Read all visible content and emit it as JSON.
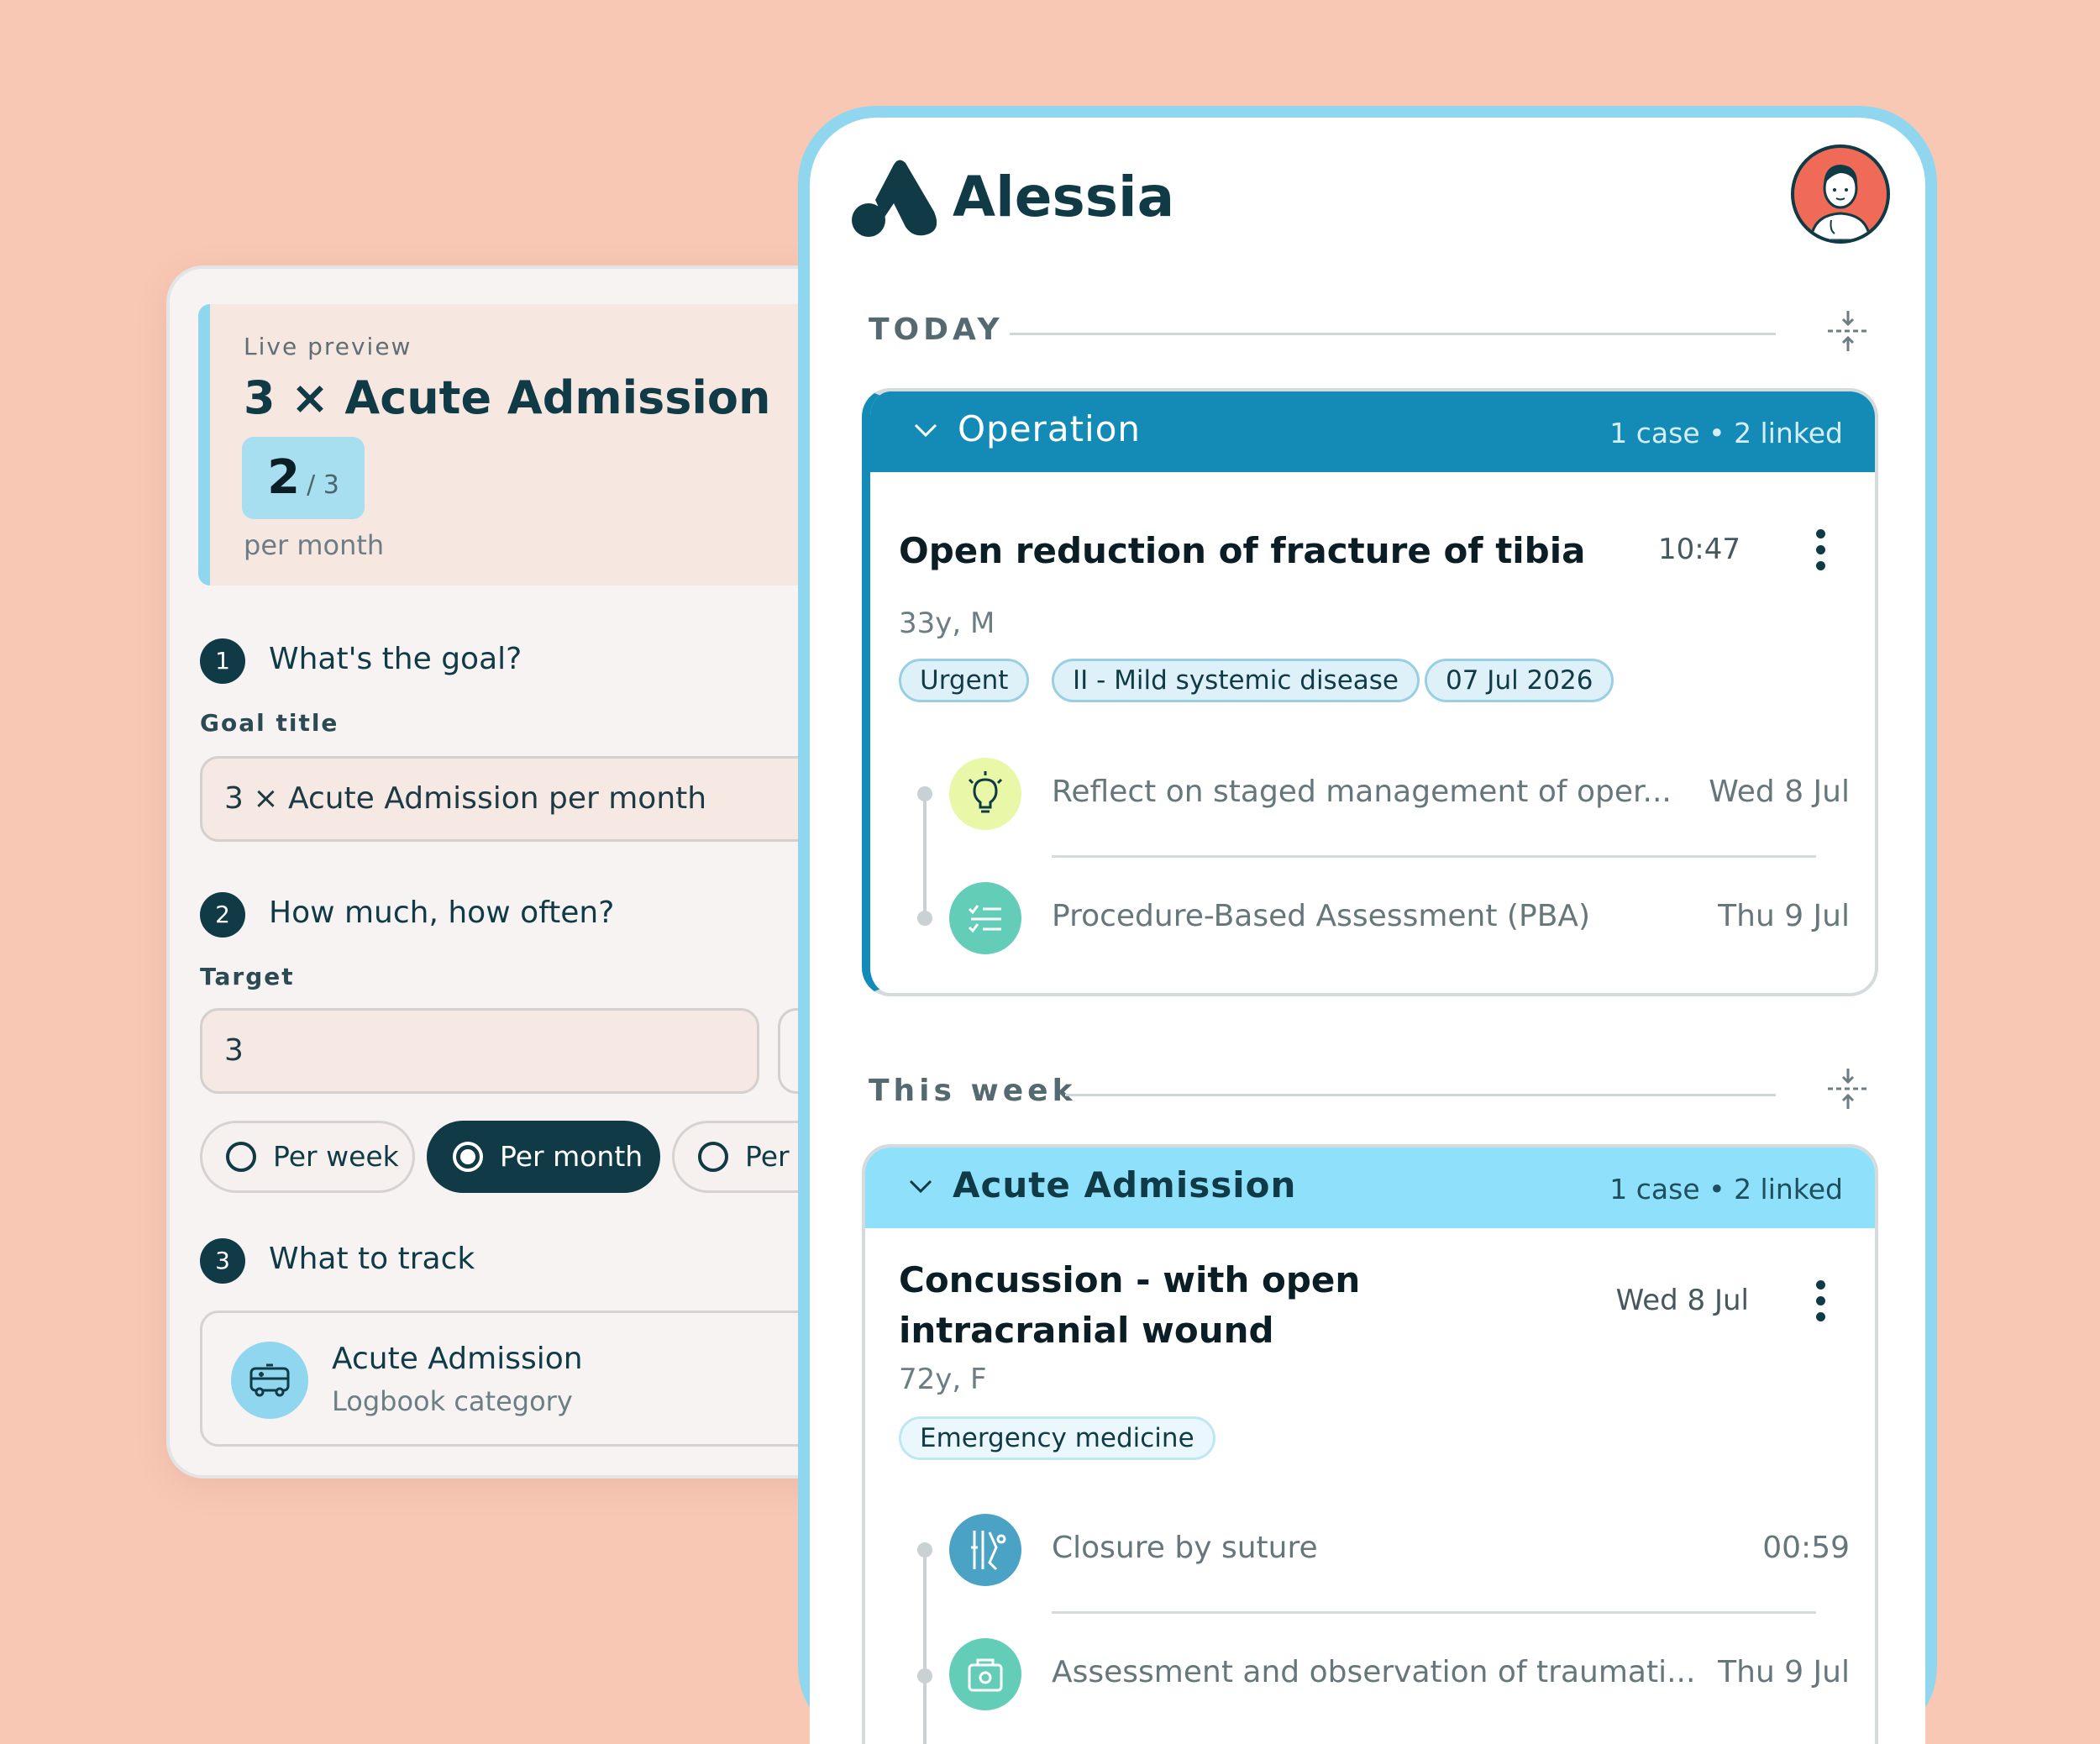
{
  "colors": {
    "background": "#f8c8b4",
    "navy": "#0f3a46",
    "operation_header": "#148bb7",
    "acute_header": "#8ee0fb",
    "phone_frame": "#8fd6ee"
  },
  "goal_card": {
    "preview": {
      "label": "Live preview",
      "title": "3 × Acute Admission",
      "progress_current": "2",
      "progress_total": "3",
      "period": "per month"
    },
    "steps": [
      {
        "number": "1",
        "title": "What's the goal?"
      },
      {
        "number": "2",
        "title": "How much, how often?"
      },
      {
        "number": "3",
        "title": "What to track"
      }
    ],
    "goal_title_label": "Goal title",
    "goal_title_value": "3 × Acute Admission per month",
    "target_label": "Target",
    "target_value": "3",
    "period_options": [
      "Per week",
      "Per month",
      "Per"
    ],
    "period_selected": "Per month",
    "track": {
      "title": "Acute Admission",
      "subtitle": "Logbook category",
      "icon": "ambulance-icon"
    }
  },
  "app": {
    "name": "Alessia",
    "avatar": "doctor-avatar"
  },
  "sections": [
    {
      "label": "TODAY",
      "group": {
        "name": "Operation",
        "meta": "1 case • 2 linked",
        "case": {
          "title": "Open reduction of fracture of tibia",
          "time": "10:47",
          "demographics": "33y, M",
          "tags": [
            "Urgent",
            "II - Mild systemic disease",
            "07 Jul 2026"
          ],
          "activities": [
            {
              "title": "Reflect on staged management of oper...",
              "date": "Wed 8 Jul",
              "icon": "lightbulb-icon"
            },
            {
              "title": "Procedure-Based Assessment (PBA)",
              "date": "Thu 9 Jul",
              "icon": "checklist-icon"
            }
          ]
        }
      }
    },
    {
      "label": "This week",
      "group": {
        "name": "Acute Admission",
        "meta": "1 case • 2 linked",
        "case": {
          "title": "Concussion - with open intracranial wound",
          "time": "Wed 8 Jul",
          "demographics": "72y, F",
          "tags": [
            "Emergency medicine"
          ],
          "activities": [
            {
              "title": "Closure by suture",
              "date": "00:59",
              "icon": "surgical-tools-icon"
            },
            {
              "title": "Assessment and observation of traumati...",
              "date": "Thu 9 Jul",
              "icon": "medical-case-icon"
            }
          ]
        }
      }
    }
  ]
}
